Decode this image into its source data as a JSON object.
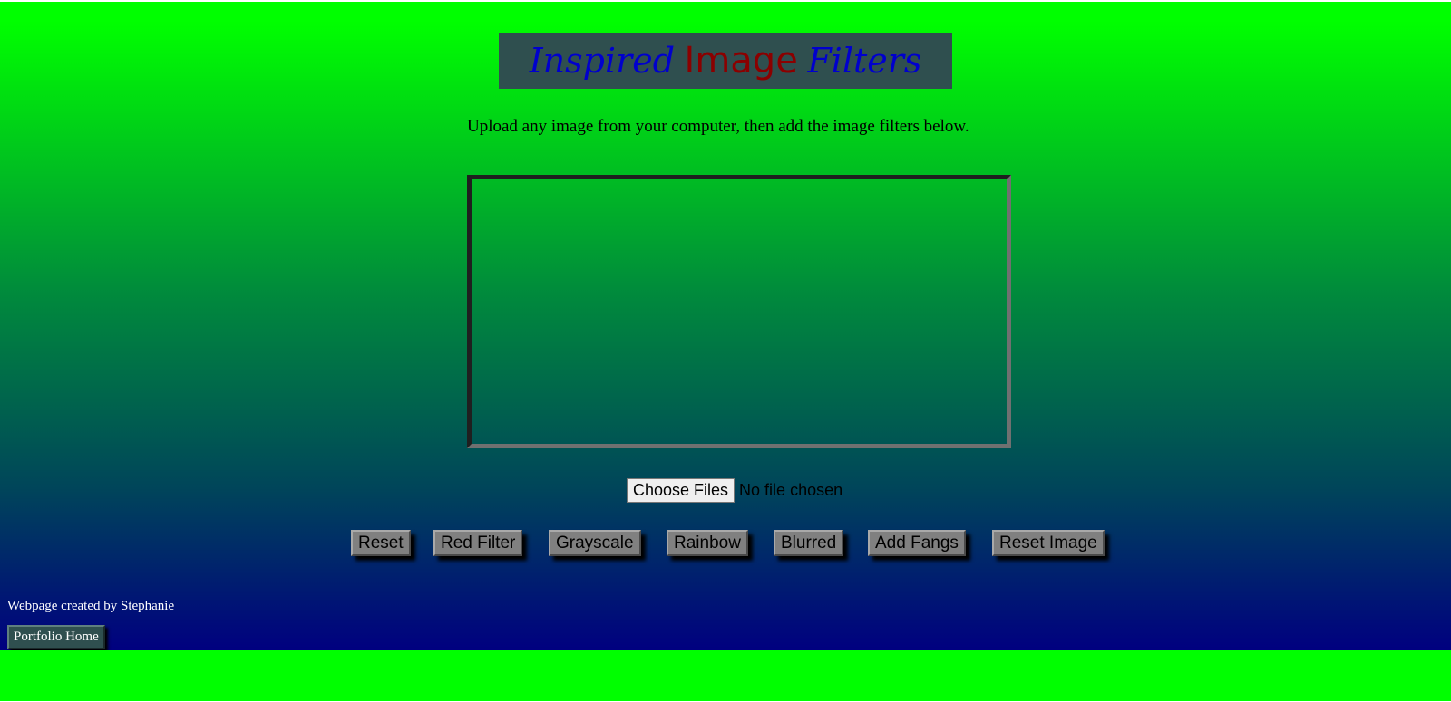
{
  "header": {
    "title_part1": "Inspired",
    "title_part2": "Image",
    "title_part3": "Filters"
  },
  "intro": {
    "text": "Upload any image from your computer, then add the image filters below."
  },
  "file_input": {
    "button_label": "Choose Files",
    "status": "No file chosen"
  },
  "filters": {
    "reset": "Reset",
    "red_filter": "Red Filter",
    "grayscale": "Grayscale",
    "rainbow": "Rainbow",
    "blurred": "Blurred",
    "add_fangs": "Add Fangs",
    "reset_image": "Reset Image"
  },
  "footer": {
    "credit": "Webpage created by Stephanie",
    "portfolio_button": "Portfolio Home"
  },
  "colors": {
    "page_gradient_top": "#00ff00",
    "page_gradient_bottom": "#000080",
    "title_box": "#2f4f4f",
    "title_italic": "#0000cd",
    "title_plain": "#8b0000",
    "button_gray": "#808080",
    "portfolio_button": "#2f4f4f"
  }
}
